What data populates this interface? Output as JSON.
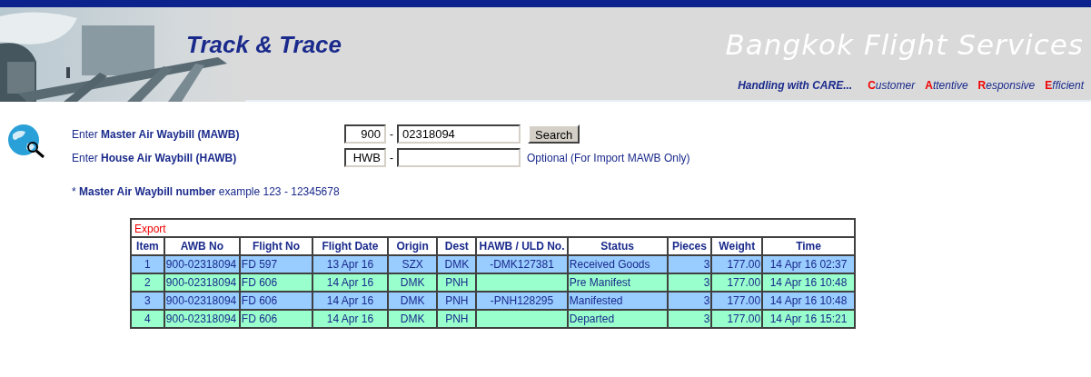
{
  "header": {
    "title": "Track & Trace",
    "company": "Bangkok Flight Services",
    "slogan": "Handling with CARE...",
    "values": [
      {
        "initial": "C",
        "rest": "ustomer"
      },
      {
        "initial": "A",
        "rest": "ttentive"
      },
      {
        "initial": "R",
        "rest": "esponsive"
      },
      {
        "initial": "E",
        "rest": "fficient"
      }
    ]
  },
  "form": {
    "mawb": {
      "label": "Enter **Master Air Waybill (MAWB)**",
      "prefix": "900",
      "separator": "-",
      "value": "02318094",
      "button": "Search"
    },
    "hawb": {
      "label": "Enter **House Air Waybill (HAWB)**",
      "prefix": "HWB",
      "separator": "-",
      "note": "Optional (For Import MAWB Only)"
    },
    "example": "* **Master Air Waybill number** example 123 - 12345678"
  },
  "table": {
    "caption": "Export",
    "columns": [
      "Item",
      "AWB No",
      "Flight No",
      "Flight Date",
      "Origin",
      "Dest",
      "HAWB / ULD No.",
      "Status",
      "Pieces",
      "Weight",
      "Time"
    ],
    "rows": [
      [
        "1",
        "900-02318094",
        "FD 597",
        "13 Apr 16",
        "SZX",
        "DMK",
        "-DMK127381",
        "Received Goods",
        "3",
        "177.00",
        "14 Apr 16 02:37"
      ],
      [
        "2",
        "900-02318094",
        "FD 606",
        "14 Apr 16",
        "DMK",
        "PNH",
        "",
        "Pre Manifest",
        "3",
        "177.00",
        "14 Apr 16 10:48"
      ],
      [
        "3",
        "900-02318094",
        "FD 606",
        "14 Apr 16",
        "DMK",
        "PNH",
        "-PNH128295",
        "Manifested",
        "3",
        "177.00",
        "14 Apr 16 10:48"
      ],
      [
        "4",
        "900-02318094",
        "FD 606",
        "14 Apr 16",
        "DMK",
        "PNH",
        "",
        "Departed",
        "3",
        "177.00",
        "14 Apr 16 15:21"
      ]
    ]
  }
}
